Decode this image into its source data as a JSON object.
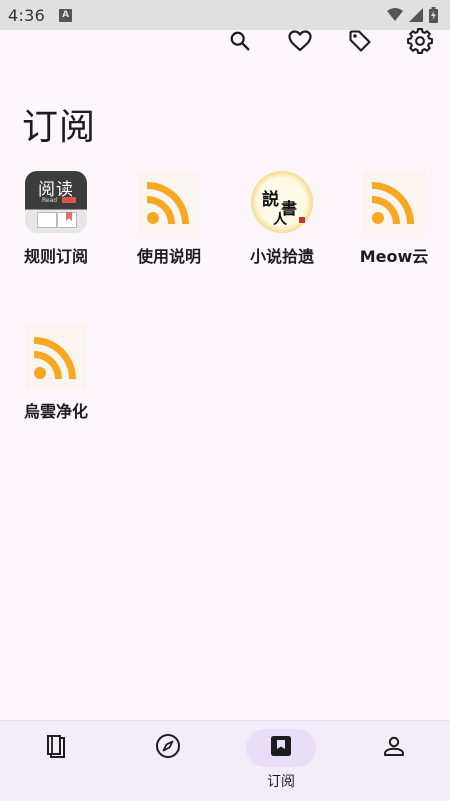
{
  "status_bar": {
    "time": "4:36",
    "notification_icon": "a-letter-icon",
    "icons": [
      "wifi-icon",
      "signal-icon",
      "battery-icon"
    ]
  },
  "toolbar": {
    "actions": [
      {
        "name": "search-icon"
      },
      {
        "name": "heart-icon"
      },
      {
        "name": "tag-icon"
      },
      {
        "name": "gear-icon"
      }
    ]
  },
  "page": {
    "title": "订阅"
  },
  "grid": {
    "items": [
      {
        "label": "规则订阅",
        "icon": "app-logo-icon",
        "tile_text": "阅读",
        "tile_sub": "Read"
      },
      {
        "label": "使用说明",
        "icon": "rss-icon"
      },
      {
        "label": "小说拾遗",
        "icon": "calligraphy-badge-icon",
        "calli_1": "説",
        "calli_2": "書",
        "calli_3": "人"
      },
      {
        "label": "Meow云",
        "icon": "rss-icon"
      },
      {
        "label": "烏雲净化",
        "icon": "rss-icon"
      }
    ]
  },
  "bottom_nav": {
    "items": [
      {
        "name": "book-icon",
        "label": ""
      },
      {
        "name": "compass-icon",
        "label": ""
      },
      {
        "name": "bookmark-icon",
        "label": "订阅",
        "active": true
      },
      {
        "name": "person-icon",
        "label": ""
      }
    ]
  },
  "colors": {
    "background": "#fdf7fc",
    "rss_orange": "#f7a823",
    "nav_active": "#e8def8",
    "nav_background": "#f3edf7"
  }
}
